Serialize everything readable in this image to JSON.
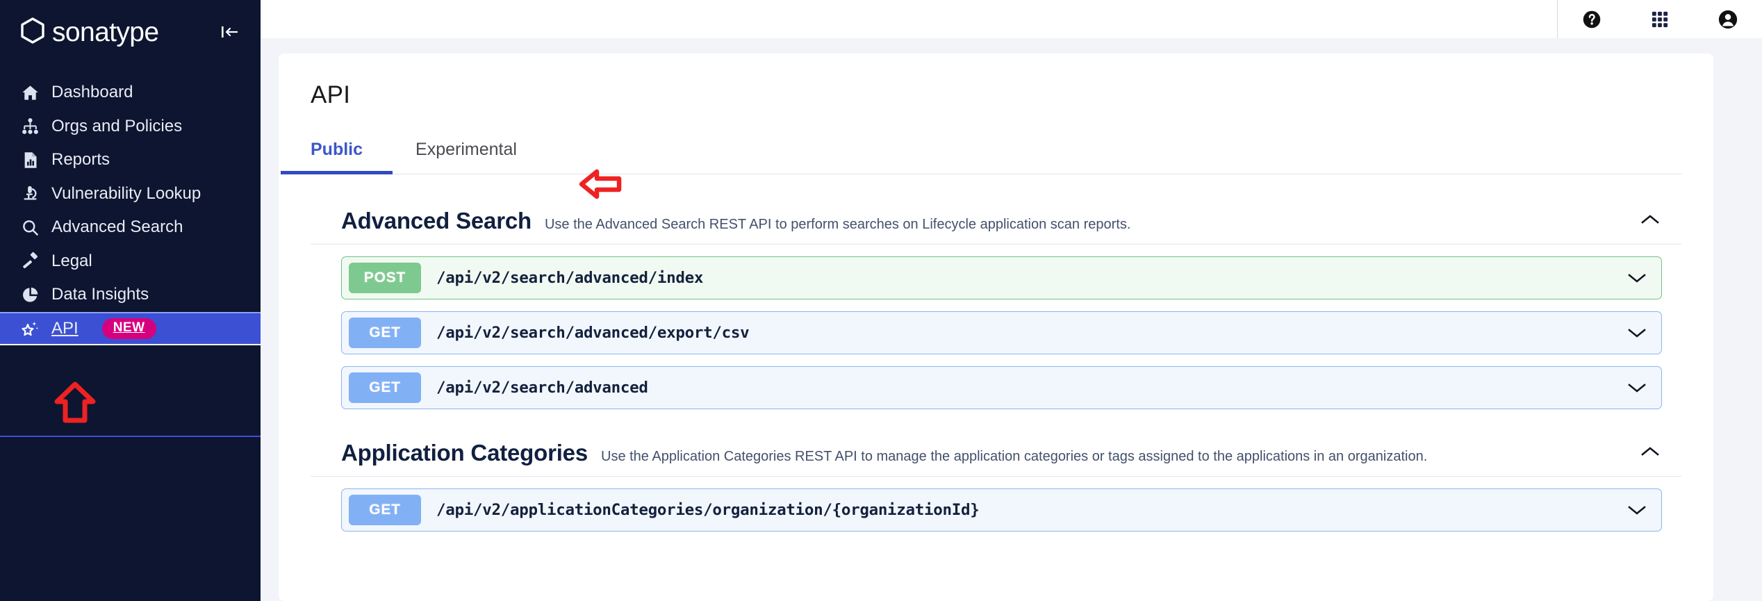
{
  "sidebar": {
    "brand": "sonatype",
    "collapse_icon": "collapse-left-icon",
    "new_badge": "NEW",
    "items": [
      {
        "label": "Dashboard",
        "icon": "home-icon",
        "active": false
      },
      {
        "label": "Orgs and Policies",
        "icon": "org-chart-icon",
        "active": false
      },
      {
        "label": "Reports",
        "icon": "report-doc-icon",
        "active": false
      },
      {
        "label": "Vulnerability Lookup",
        "icon": "microscope-icon",
        "active": false
      },
      {
        "label": "Advanced Search",
        "icon": "magnifier-icon",
        "active": false
      },
      {
        "label": "Legal",
        "icon": "gavel-icon",
        "active": false
      },
      {
        "label": "Data Insights",
        "icon": "pie-chart-icon",
        "active": false
      },
      {
        "label": "API",
        "icon": "sparkle-star-icon",
        "active": true
      }
    ]
  },
  "topbar": {
    "icons": [
      {
        "name": "help-icon"
      },
      {
        "name": "apps-grid-icon"
      },
      {
        "name": "user-account-icon"
      }
    ]
  },
  "main": {
    "page_title": "API",
    "tabs": [
      {
        "label": "Public",
        "active": true
      },
      {
        "label": "Experimental",
        "active": false
      }
    ],
    "sections": [
      {
        "title": "Advanced Search",
        "description": "Use the Advanced Search REST API to perform searches on Lifecycle application scan reports.",
        "expanded": true,
        "collapse_icon": "chevron-up-icon",
        "endpoints": [
          {
            "method": "POST",
            "path": "/api/v2/search/advanced/index",
            "expand_icon": "chevron-down-icon"
          },
          {
            "method": "GET",
            "path": "/api/v2/search/advanced/export/csv",
            "expand_icon": "chevron-down-icon"
          },
          {
            "method": "GET",
            "path": "/api/v2/search/advanced",
            "expand_icon": "chevron-down-icon"
          }
        ]
      },
      {
        "title": "Application Categories",
        "description": "Use the Application Categories REST API to manage the application categories or tags assigned to the applications in an organization.",
        "expanded": true,
        "collapse_icon": "chevron-up-icon",
        "endpoints": [
          {
            "method": "GET",
            "path": "/api/v2/applicationCategories/organization/{organizationId}",
            "expand_icon": "chevron-down-icon"
          }
        ]
      }
    ]
  },
  "annotations": [
    {
      "name": "red-arrow-up",
      "color": "#ee2222",
      "points_at": "sidebar-item-api"
    },
    {
      "name": "red-arrow-left",
      "color": "#ee2222",
      "points_at": "tab-experimental"
    }
  ],
  "colors": {
    "sidebar_bg": "#0d1530",
    "active_nav": "#3c50d4",
    "new_badge": "#d6007f",
    "tab_active": "#2f4bbf",
    "get_badge": "#82b0f5",
    "post_badge": "#7ec98f",
    "page_bg": "#f2f4fa"
  }
}
